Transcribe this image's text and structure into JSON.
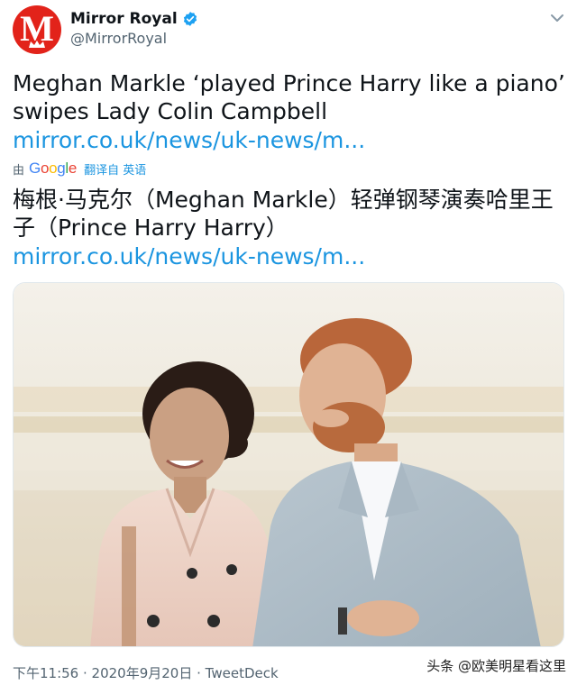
{
  "account": {
    "display_name": "Mirror Royal",
    "handle": "@MirrorRoyal",
    "verified": true,
    "avatar_letter": "M",
    "avatar_color": "#e2231a"
  },
  "tweet": {
    "text_line_1": "Meghan Markle ‘played Prince Harry like a piano’",
    "text_line_2": "swipes Lady Colin Campbell",
    "link": "mirror.co.uk/news/uk-news/m...",
    "translated_by_prefix": "由",
    "translated_by_service": "Google",
    "translate_action": "翻译自 英语",
    "translation_line_1": "梅根·马克尔（Meghan Markle）轻弹钢琴演奏哈里王",
    "translation_line_2": "子（Prince Harry Harry）",
    "translation_link": "mirror.co.uk/news/uk-news/m...",
    "timestamp": "下午11:56 · 2020年9月20日",
    "source": "TweetDeck"
  },
  "watermark": "头条 @欧美明星看这里",
  "icons": {
    "more": "chevron-down-icon",
    "verified": "verified-badge-icon"
  },
  "colors": {
    "link": "#1b95e0",
    "verified": "#1da1f2",
    "secondary_text": "#536471"
  }
}
